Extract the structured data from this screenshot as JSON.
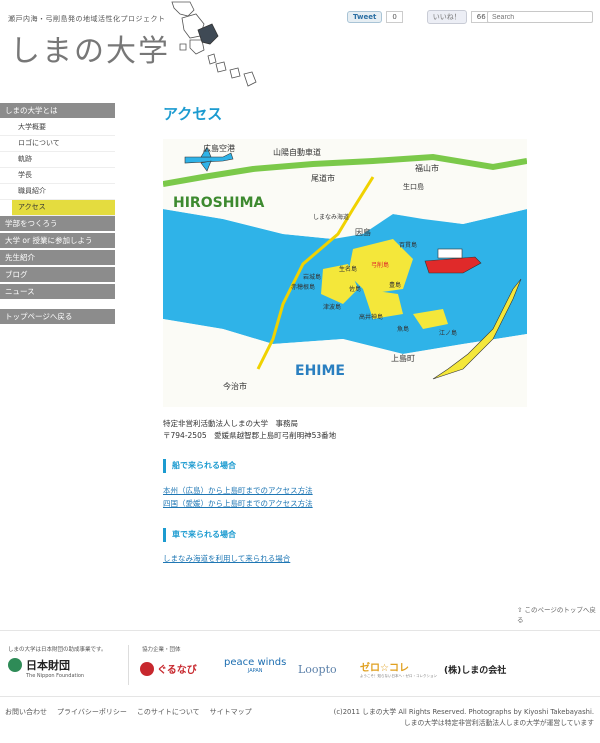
{
  "header": {
    "tagline": "瀬戸内海・弓削島発の地域活性化プロジェクト",
    "logo": "しまの大学",
    "tweet_label": "Tweet",
    "tweet_count": "0",
    "like_label": "いいね！",
    "like_count": "66",
    "search_placeholder": "Search"
  },
  "sidebar": {
    "items": [
      {
        "label": "しまの大学とは"
      },
      {
        "label": "大学概要"
      },
      {
        "label": "ロゴについて"
      },
      {
        "label": "軌跡"
      },
      {
        "label": "学長"
      },
      {
        "label": "職員紹介"
      },
      {
        "label": "アクセス"
      },
      {
        "label": "学部をつくろう"
      },
      {
        "label": "大学 or 授業に参加しよう"
      },
      {
        "label": "先生紹介"
      },
      {
        "label": "ブログ"
      },
      {
        "label": "ニュース"
      },
      {
        "label": "トップページへ戻る"
      }
    ]
  },
  "main": {
    "title": "アクセス",
    "map_labels": {
      "airport": "広島空港",
      "expressway": "山陽自動車道",
      "fukuyama": "福山市",
      "onomichi": "尾道市",
      "hiroshima": "HIROSHIMA",
      "shimanami": "しまなみ海道",
      "innoshima": "因島",
      "ikuchi": "生口島",
      "setoda": "生名島",
      "yuge": "弓削島",
      "iwagi": "岩城島",
      "akahoshi": "赤穂根島",
      "sashima": "佐島",
      "tsuhama": "津波島",
      "takai": "高井神島",
      "ehime": "EHIME",
      "imabari": "今治市",
      "kamijima": "上島町",
      "uoshima": "魚島",
      "eshima": "江ノ島",
      "momoshima": "百貫島",
      "sakuma": "豊島"
    },
    "address_line1": "特定非営利活動法人しまの大学　事務局",
    "address_line2": "〒794-2505　愛媛県越智郡上島町弓削明神53番地",
    "section1_title": "船で来られる場合",
    "section1_links": [
      "本州（広島）から上島町までのアクセス方法",
      "四国（愛媛）から上島町までのアクセス方法"
    ],
    "section2_title": "車で来られる場合",
    "section2_links": [
      "しまなみ海道を利用して来られる場合"
    ],
    "pagetop": "このページのトップへ戻る"
  },
  "sponsors": {
    "note": "しまの大学は日本財団の助成事業です。",
    "label": "協力企業・団体",
    "nippon": "日本財団",
    "nippon_en": "The Nippon Foundation",
    "gurunavi": "ぐるなび",
    "peacewinds": "peace winds",
    "peacewinds_sub": "JAPAN",
    "loopto": "Loopto",
    "zerokore": "ゼロ☆コレ",
    "zerokore_sub": "ようこそ！知らない日本へ・ゼロ・コレクション",
    "shima": "(株)しまの会社"
  },
  "footer": {
    "links": [
      "お問い合わせ",
      "プライバシーポリシー",
      "このサイトについて",
      "サイトマップ"
    ],
    "copyright1": "(c)2011 しまの大学 All Rights Reserved. Photographs by Kiyoshi Takebayashi.",
    "copyright2": "しまの大学は特定非営利活動法人しまの大学が運営しています"
  },
  "colors": {
    "accent_blue": "#1c9bd0",
    "active_yellow": "#e4dc3f",
    "sidebar_gray": "#8c8c8c"
  }
}
